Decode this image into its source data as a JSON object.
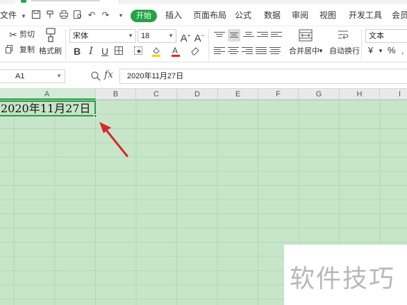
{
  "menu": {
    "file_label": "文件",
    "tabs": [
      {
        "label": "开始"
      },
      {
        "label": "插入"
      },
      {
        "label": "页面布局"
      },
      {
        "label": "公式"
      },
      {
        "label": "数据"
      },
      {
        "label": "审阅"
      },
      {
        "label": "视图"
      },
      {
        "label": "开发工具"
      },
      {
        "label": "会员"
      }
    ]
  },
  "ribbon": {
    "cut_label": "剪切",
    "copy_label": "复制",
    "format_painter_label": "格式刷",
    "font_name": "宋体",
    "font_size": "18",
    "merge_label": "合并居中",
    "wrap_label": "自动换行",
    "number_format": "文本",
    "currency_symbol": "¥",
    "percent_symbol": "%"
  },
  "formula_bar": {
    "name_box": "A1",
    "fx_label": "fx",
    "content": "2020年11月27日"
  },
  "sheet": {
    "columns": [
      "A",
      "B",
      "C",
      "D",
      "E",
      "F",
      "G",
      "H",
      "I"
    ],
    "active_cell_value": "2020年11月27日"
  },
  "watermark": {
    "text": "软件技巧"
  },
  "colors": {
    "accent": "#23a345",
    "sheet_background": "#c7e6c9",
    "arrow": "#d9262b"
  }
}
